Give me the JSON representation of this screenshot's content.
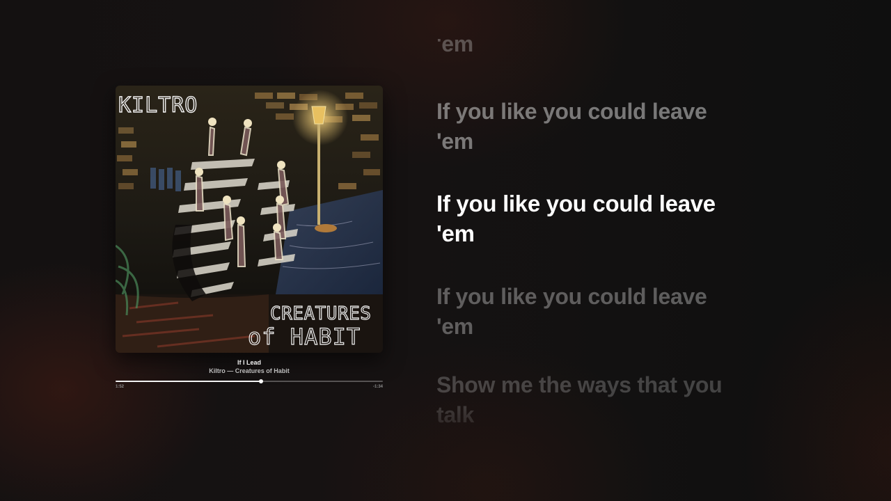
{
  "player": {
    "artwork": {
      "band_text": "KILTRO",
      "album_text_1": "CREATURES",
      "album_text_2": "of HABIT"
    },
    "track": {
      "title": "If I Lead",
      "subtitle": "Kiltro — Creatures of Habit"
    },
    "progress": {
      "elapsed": "1:52",
      "remaining": "-1:34",
      "fraction": 0.544
    }
  },
  "lyrics": {
    "previous": [
      "'em"
    ],
    "near": [
      "If you like you could leave",
      "'em"
    ],
    "active": [
      "If you like you could leave",
      "'em"
    ],
    "next": [
      "If you like you could leave",
      "'em"
    ],
    "far": [
      "Show me the ways that you",
      "talk"
    ]
  },
  "colors": {
    "active_lyric": "#ffffff",
    "background": "#111111"
  }
}
